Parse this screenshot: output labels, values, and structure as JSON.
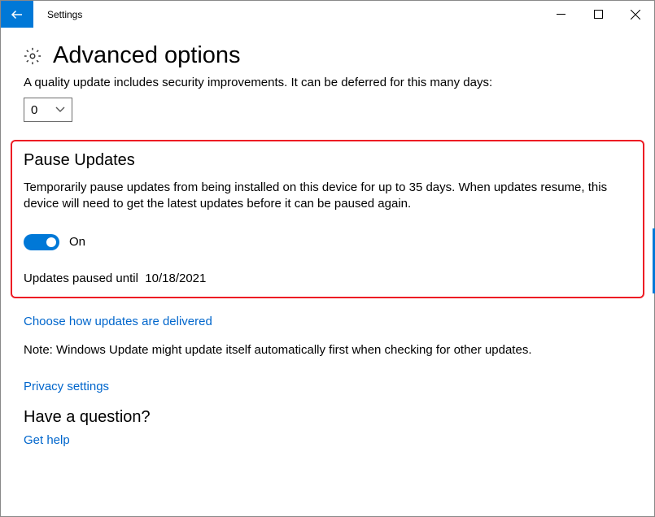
{
  "titlebar": {
    "title": "Settings"
  },
  "page": {
    "title": "Advanced options",
    "quality_text": "A quality update includes security improvements. It can be deferred for this many days:",
    "defer_value": "0"
  },
  "pause": {
    "heading": "Pause Updates",
    "description": "Temporarily pause updates from being installed on this device for up to 35 days. When updates resume, this device will need to get the latest updates before it can be paused again.",
    "toggle_state": "On",
    "paused_until_label": "Updates paused until",
    "paused_until_date": "10/18/2021"
  },
  "links": {
    "delivery": "Choose how updates are delivered",
    "note": "Note: Windows Update might update itself automatically first when checking for other updates.",
    "privacy": "Privacy settings",
    "question": "Have a question?",
    "help": "Get help"
  }
}
